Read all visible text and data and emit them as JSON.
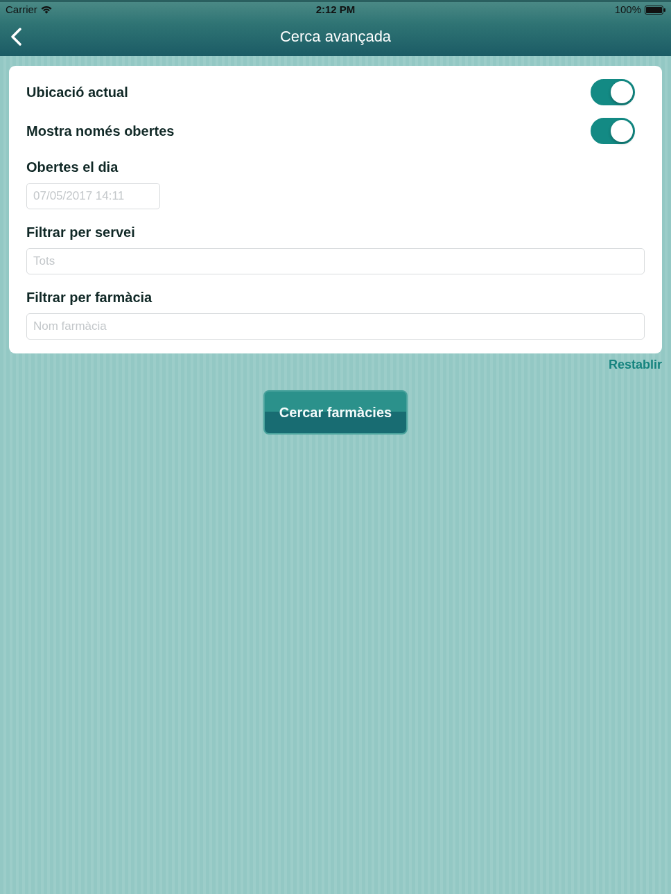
{
  "status_bar": {
    "carrier": "Carrier",
    "time": "2:12 PM",
    "battery": "100%"
  },
  "nav_bar": {
    "title": "Cerca avançada"
  },
  "form": {
    "toggles": [
      {
        "label": "Ubicació actual",
        "on": true
      },
      {
        "label": "Mostra només obertes",
        "on": true
      }
    ],
    "fields": [
      {
        "label": "Obertes el dia",
        "placeholder": "07/05/2017 14:11",
        "kind": "date"
      },
      {
        "label": "Filtrar per servei",
        "placeholder": "Tots",
        "kind": "text"
      },
      {
        "label": "Filtrar per farmàcia",
        "placeholder": "Nom farmàcia",
        "kind": "text"
      }
    ]
  },
  "reset_link": "Restablir",
  "search_button": "Cercar farmàcies"
}
